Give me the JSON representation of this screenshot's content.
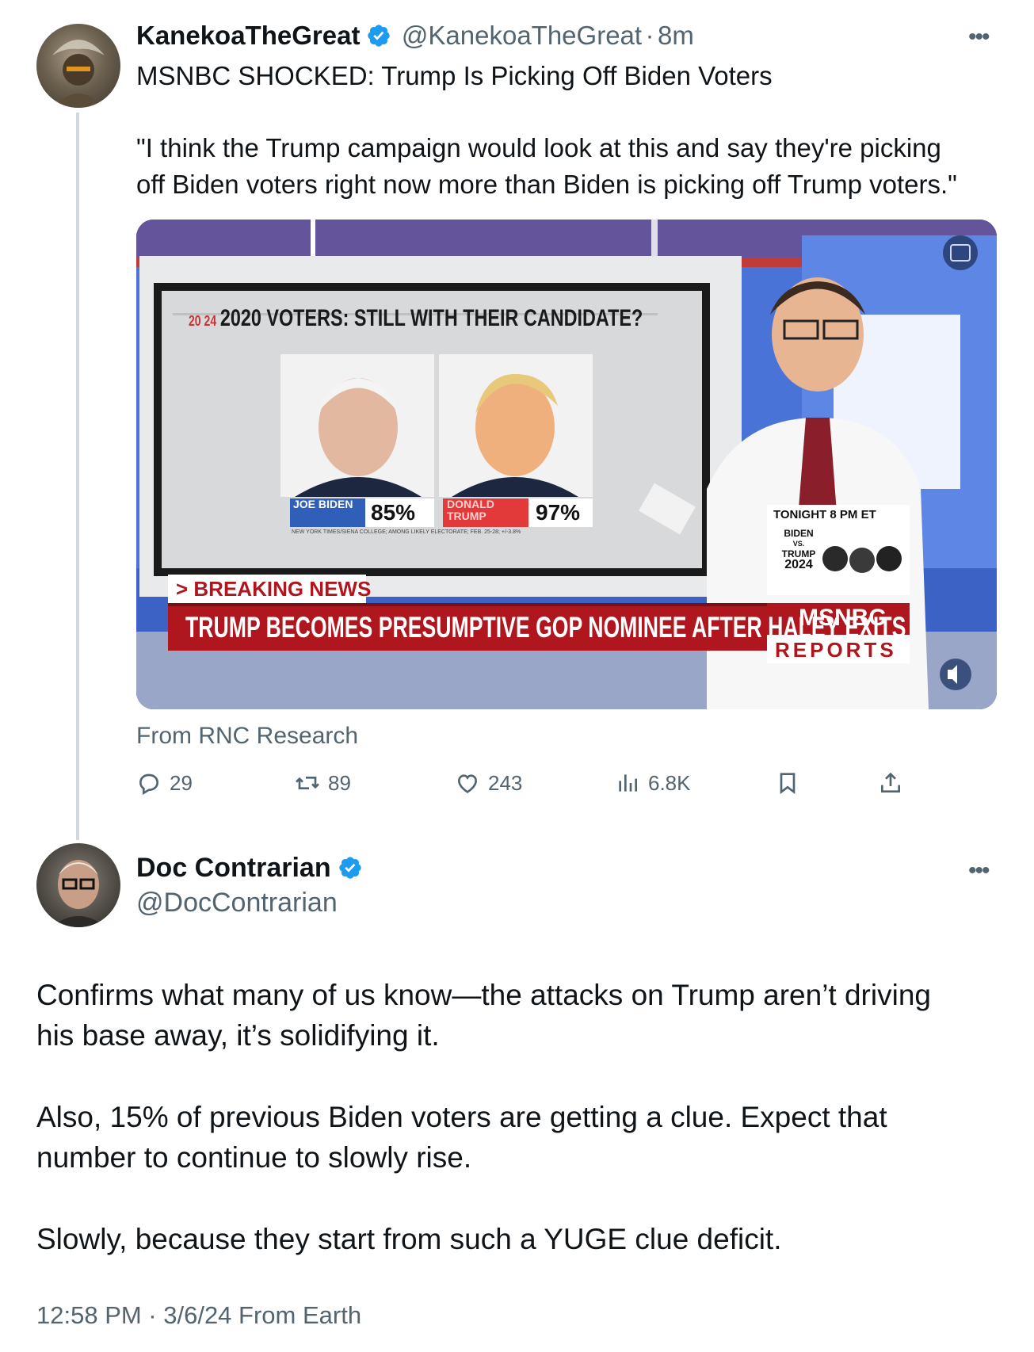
{
  "tweet1": {
    "author_name": "KanekoaTheGreat",
    "author_handle": "@KanekoaTheGreat",
    "time": "8m",
    "separator": "·",
    "headline": "MSNBC SHOCKED: Trump Is Picking Off Biden Voters",
    "quote_line1": "\"I think the Trump campaign would look at this and say they're picking",
    "quote_line2": "off Biden voters right now more than Biden is picking off Trump voters.\"",
    "media": {
      "screen_title": "2020 VOTERS: STILL WITH THEIR CANDIDATE?",
      "logo_year": "20 24",
      "candidate1_label": "JOE BIDEN",
      "candidate1_value": "85%",
      "candidate2_label": "DONALD TRUMP",
      "candidate2_value": "97%",
      "source_note": "NEW YORK TIMES/SIENA COLLEGE; AMONG LIKELY ELECTORATE; FEB. 25-28; +/-3.8%",
      "breaking_label": "> BREAKING NEWS",
      "chyron": "TRUMP BECOMES PRESUMPTIVE GOP NOMINEE AFTER HALEY EXITS",
      "promo_title": "TONIGHT 8 PM ET",
      "promo_line1": "BIDEN",
      "promo_line2": "VS.",
      "promo_line3": "TRUMP",
      "promo_line4": "2024",
      "network": "MSNBC",
      "network_sub": "REPORTS"
    },
    "source": "From RNC Research",
    "stats": {
      "replies": "29",
      "retweets": "89",
      "likes": "243",
      "views": "6.8K"
    }
  },
  "tweet2": {
    "author_name": "Doc Contrarian",
    "author_handle": "@DocContrarian",
    "para1_line1": "Confirms what many of us know—the attacks on Trump aren’t driving",
    "para1_line2": "his base away, it’s solidifying it.",
    "para2_line1": "Also, 15% of previous Biden voters are getting a clue. Expect that",
    "para2_line2": "number to continue to slowly rise.",
    "para3": "Slowly, because they start from such a YUGE clue deficit.",
    "meta": "12:58 PM · 3/6/24 From Earth"
  },
  "colors": {
    "verified_blue": "#1d9bf0",
    "secondary_text": "#536471",
    "chyron_red": "#b0161e"
  }
}
